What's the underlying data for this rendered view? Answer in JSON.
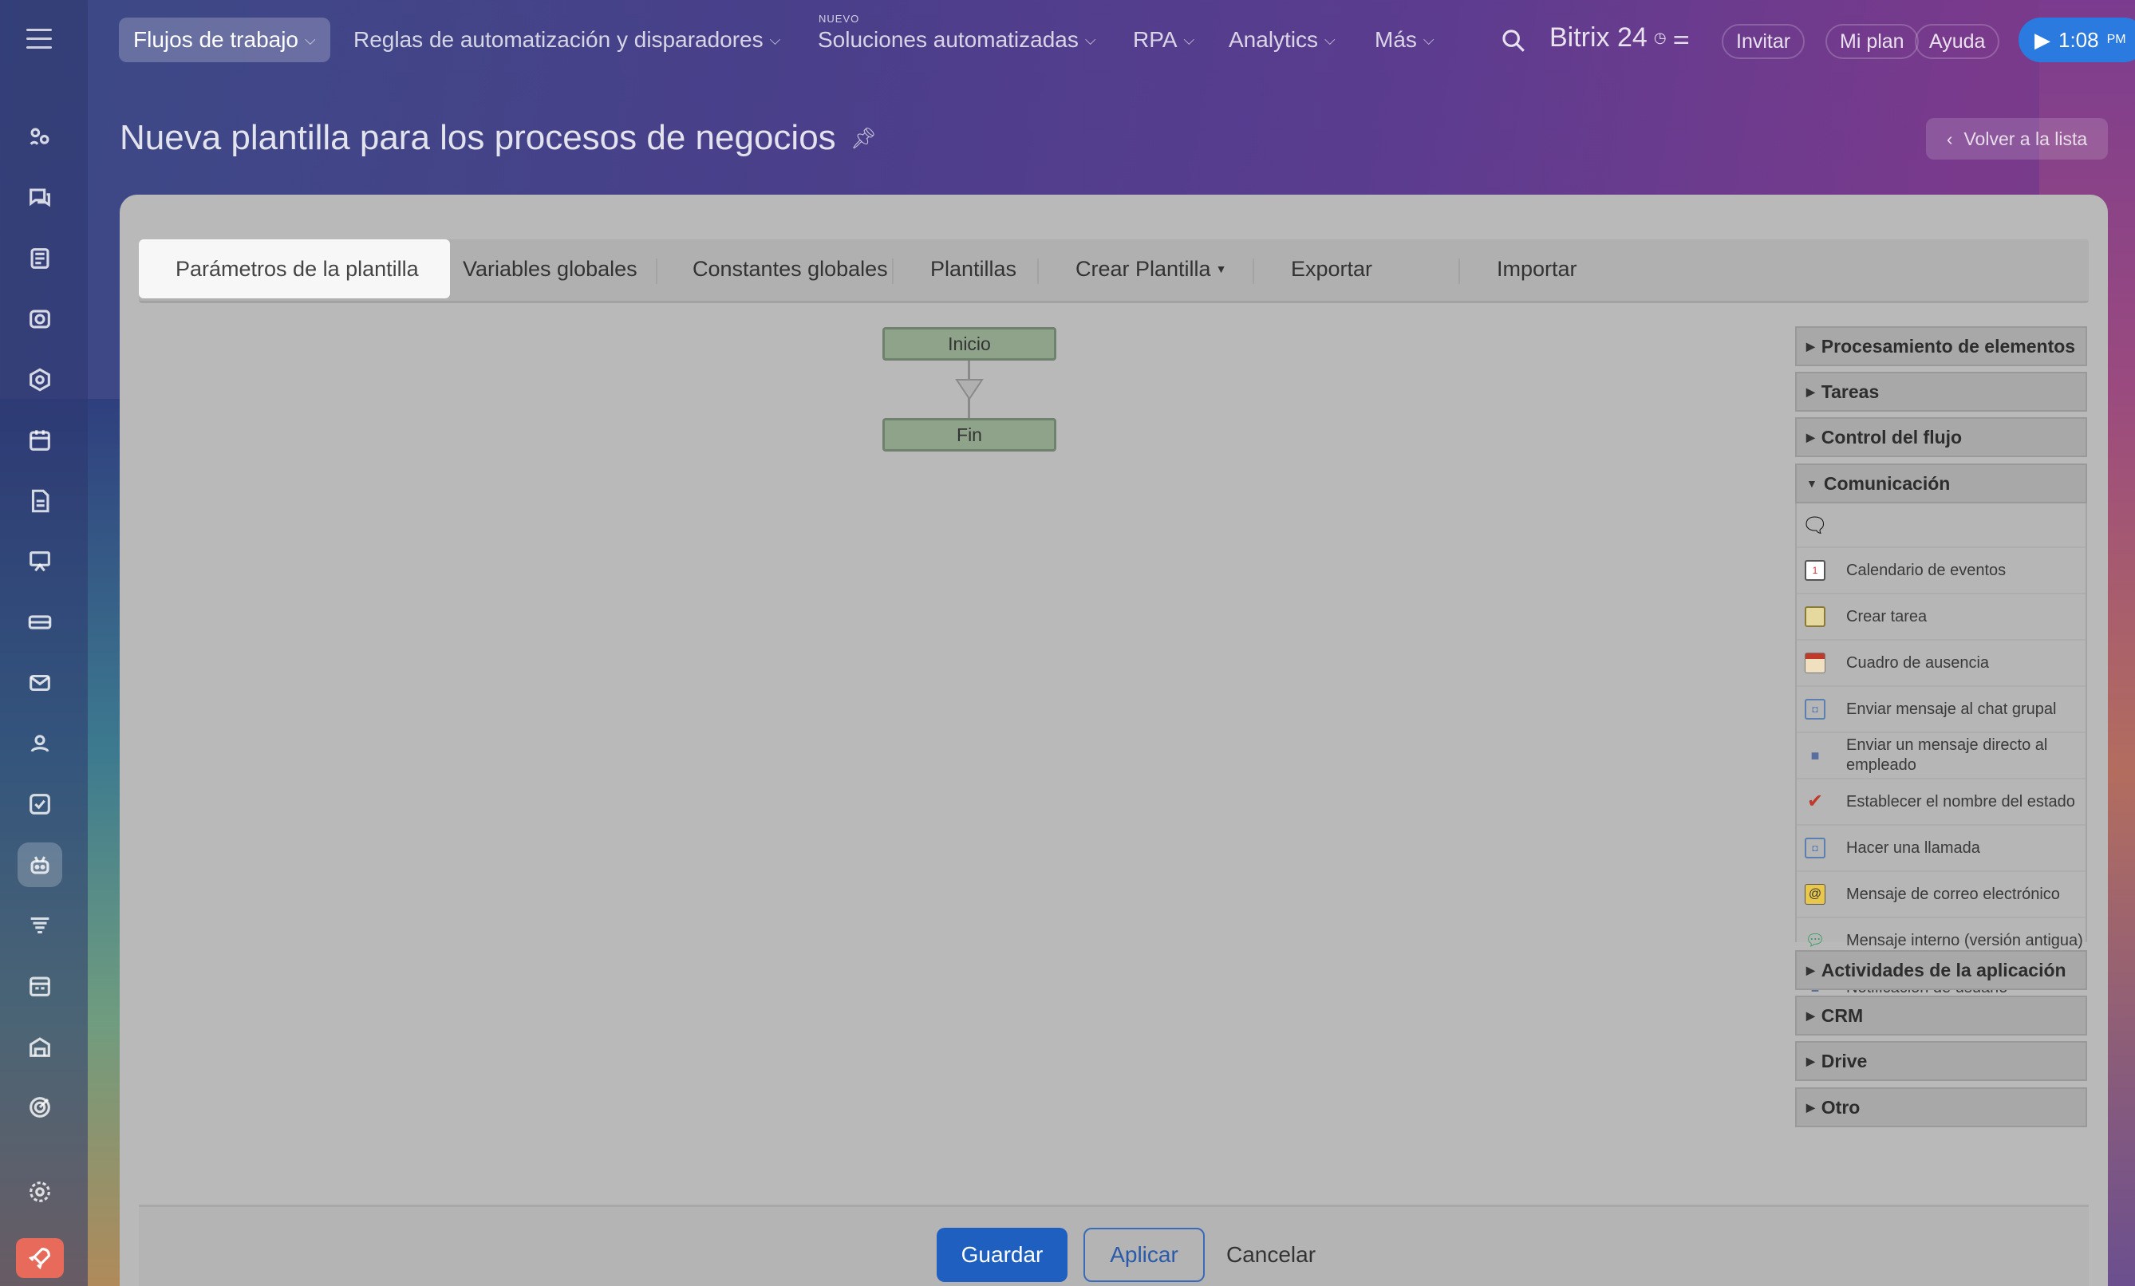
{
  "topbar": {
    "nav": [
      {
        "label": "Flujos de trabajo"
      },
      {
        "label": "Reglas de automatización y disparadores"
      },
      {
        "label": "Soluciones automatizadas",
        "badge": "NUEVO"
      },
      {
        "label": "RPA"
      },
      {
        "label": "Analytics"
      },
      {
        "label": "Más"
      }
    ],
    "brand": "Bitrix 24",
    "invite": "Invitar",
    "my_plan": "Mi plan",
    "help": "Ayuda",
    "time": "1:08",
    "time_suffix": "PM"
  },
  "page": {
    "title": "Nueva plantilla para los procesos de negocios",
    "back_label": "Volver a la lista"
  },
  "tabs": [
    {
      "label": "Parámetros de la plantilla"
    },
    {
      "label": "Variables globales"
    },
    {
      "label": "Constantes globales"
    },
    {
      "label": "Plantillas"
    },
    {
      "label": "Crear Plantilla"
    },
    {
      "label": "Exportar"
    },
    {
      "label": "Importar"
    }
  ],
  "workflow": {
    "start": "Inicio",
    "end": "Fin"
  },
  "toolbox": {
    "groups": [
      {
        "label": "Procesamiento de elementos"
      },
      {
        "label": "Tareas"
      },
      {
        "label": "Control del flujo"
      },
      {
        "label": "Comunicación"
      },
      {
        "label": "Actividades de la aplicación"
      },
      {
        "label": "CRM"
      },
      {
        "label": "Drive"
      },
      {
        "label": "Otro"
      }
    ],
    "communication_items": [
      {
        "label": "Calendario de eventos",
        "icon": "calendar-icon"
      },
      {
        "label": "Crear tarea",
        "icon": "task-icon"
      },
      {
        "label": "Cuadro de ausencia",
        "icon": "absence-icon"
      },
      {
        "label": "Enviar mensaje al chat grupal",
        "icon": "group-chat-icon"
      },
      {
        "label": "Enviar un mensaje directo al empleado",
        "icon": "direct-message-icon"
      },
      {
        "label": "Establecer el nombre del estado",
        "icon": "checkmark-icon"
      },
      {
        "label": "Hacer una llamada",
        "icon": "call-icon"
      },
      {
        "label": "Mensaje de correo electrónico",
        "icon": "email-icon"
      },
      {
        "label": "Mensaje interno (versión antigua)",
        "icon": "internal-message-icon"
      },
      {
        "label": "Notificación de usuario",
        "icon": "notification-icon"
      }
    ]
  },
  "footer": {
    "save": "Guardar",
    "apply": "Aplicar",
    "cancel": "Cancelar"
  },
  "colors": {
    "primary_button": "#1f5fbf",
    "timer": "#2a7ae0",
    "node_fill": "#8fa38b"
  }
}
